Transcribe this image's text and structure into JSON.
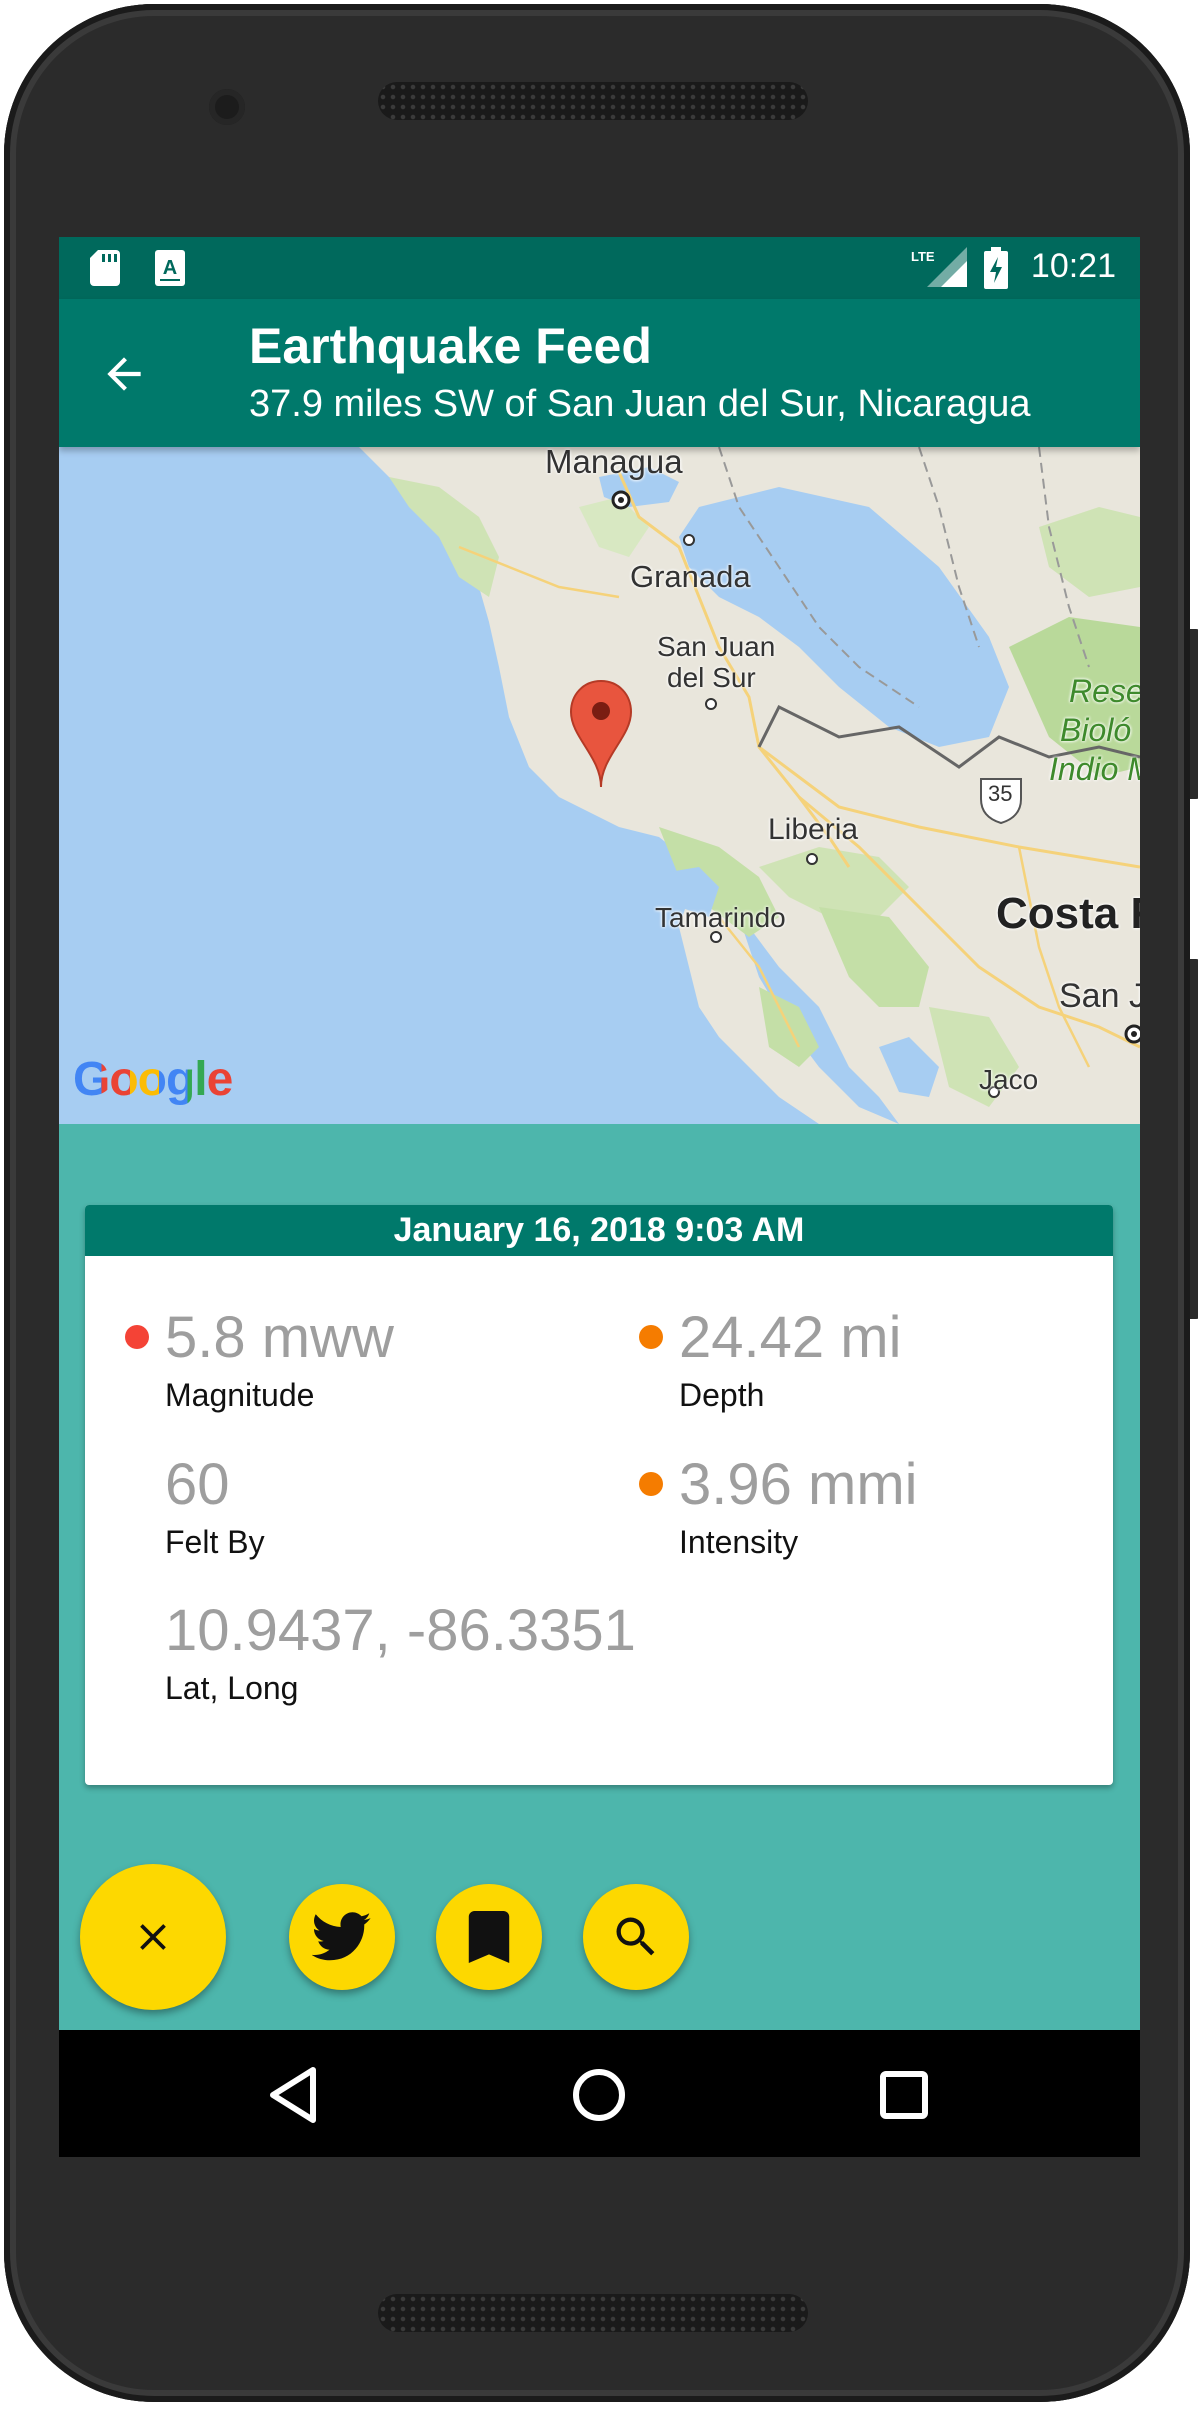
{
  "status_bar": {
    "time": "10:21",
    "network": "LTE",
    "icons": [
      "sd-card-icon",
      "font-a-icon",
      "lte-signal-icon",
      "battery-charging-icon"
    ]
  },
  "app_bar": {
    "title": "Earthquake Feed",
    "subtitle": "37.9 miles SW of San Juan del Sur, Nicaragua",
    "back_icon": "arrow-back-icon"
  },
  "map": {
    "labels": {
      "managua": "Managua",
      "granada": "Granada",
      "san_juan_1": "San Juan",
      "san_juan_2": "del Sur",
      "liberia": "Liberia",
      "tamarindo": "Tamarindo",
      "costa": "Costa R",
      "san_j": "San J",
      "jaco": "Jaco",
      "reserve_1": "Rese",
      "reserve_2": "Bioló",
      "reserve_3": "Indio M",
      "route": "35"
    },
    "attribution": "Google",
    "marker_icon": "map-pin-icon"
  },
  "card": {
    "date": "January 16, 2018 9:03 AM",
    "stats": {
      "magnitude": {
        "value": "5.8 mww",
        "label": "Magnitude",
        "dot_color": "#f44336"
      },
      "depth": {
        "value": "24.42 mi",
        "label": "Depth",
        "dot_color": "#f57c00"
      },
      "felt_by": {
        "value": "60",
        "label": "Felt By"
      },
      "intensity": {
        "value": "3.96 mmi",
        "label": "Intensity",
        "dot_color": "#f57c00"
      },
      "lat_long": {
        "value": "10.9437, -86.3351",
        "label": "Lat, Long"
      }
    }
  },
  "actions": {
    "close_icon": "close-icon",
    "twitter_icon": "twitter-icon",
    "bookmark_icon": "bookmark-icon",
    "search_icon": "search-icon"
  },
  "nav_bar": {
    "icons": [
      "back-triangle-icon",
      "home-circle-icon",
      "recents-square-icon"
    ]
  },
  "colors": {
    "status_bar": "#00695c",
    "app_bar": "#00796b",
    "background": "#4db6ac",
    "fab": "#fdd800",
    "water": "#a7cdf2"
  }
}
